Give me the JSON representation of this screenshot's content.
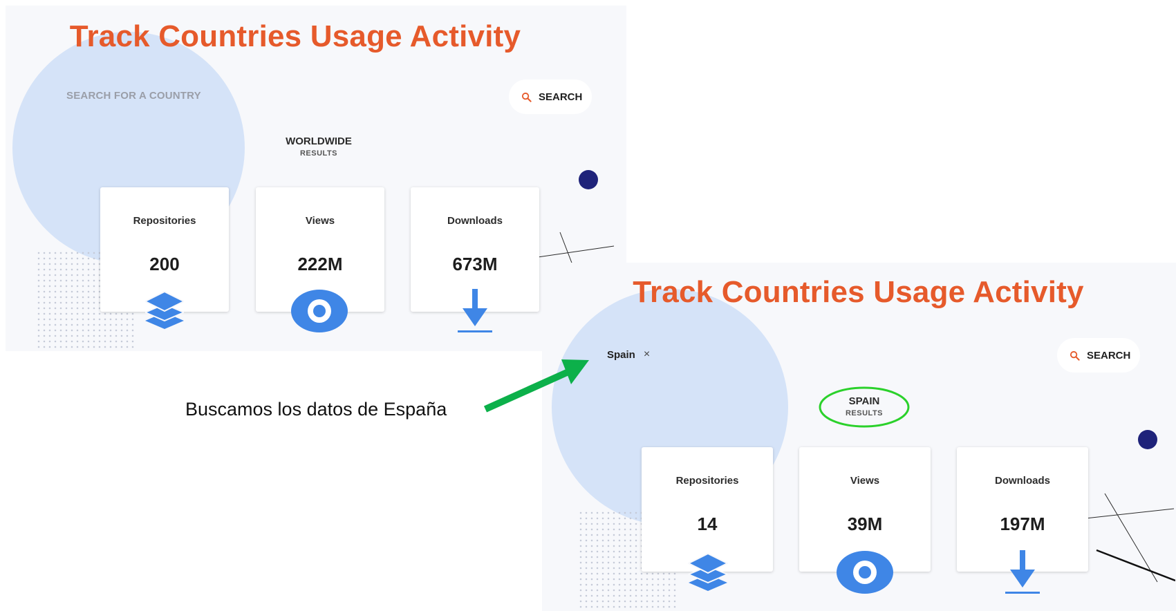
{
  "screen_before": {
    "title": "Track Countries Usage Activity",
    "search_placeholder": "SEARCH FOR A COUNTRY",
    "search_button": "SEARCH",
    "results_heading": "WORLDWIDE",
    "results_sub": "RESULTS",
    "cards": [
      {
        "label": "Repositories",
        "value": "200",
        "icon": "layers-icon"
      },
      {
        "label": "Views",
        "value": "222M",
        "icon": "eye-icon"
      },
      {
        "label": "Downloads",
        "value": "673M",
        "icon": "download-icon"
      }
    ]
  },
  "screen_after": {
    "title": "Track Countries Usage Activity",
    "search_value": "Spain",
    "clear_symbol": "×",
    "search_button": "SEARCH",
    "results_heading": "SPAIN",
    "results_sub": "RESULTS",
    "cards": [
      {
        "label": "Repositories",
        "value": "14",
        "icon": "layers-icon"
      },
      {
        "label": "Views",
        "value": "39M",
        "icon": "eye-icon"
      },
      {
        "label": "Downloads",
        "value": "197M",
        "icon": "download-icon"
      }
    ]
  },
  "annotation": {
    "caption": "Buscamos los datos de España"
  },
  "colors": {
    "title": "#e65a2b",
    "icon_blue": "#3f86e6",
    "accent_navy": "#1f237a",
    "annotation_green": "#0cb04a",
    "panel_bg": "#f7f8fb",
    "circle": "#d5e3f8"
  }
}
